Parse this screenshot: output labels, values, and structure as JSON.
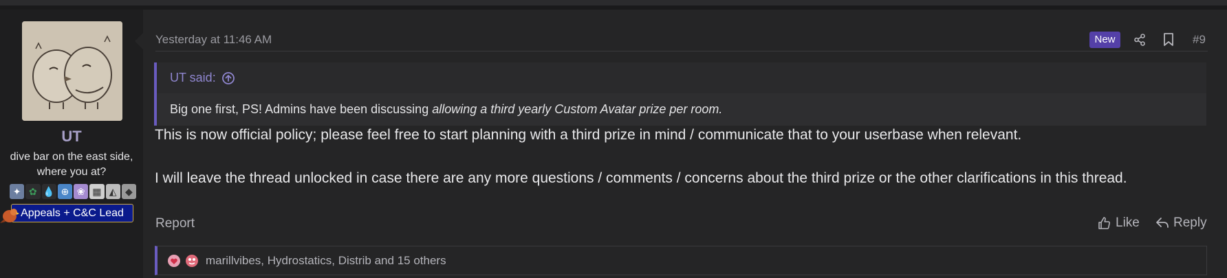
{
  "user": {
    "name": "UT",
    "title": "dive bar on the east side, where you at?",
    "role_banner": "Appeals + C&C Lead",
    "badge_colors": [
      "#6c7fa0",
      "#3c9a5a",
      "#2e7bd6",
      "#4a86c8",
      "#a58bd0",
      "#cfcfcf",
      "#bdbdbd",
      "#9a9a9a"
    ]
  },
  "post": {
    "date": "Yesterday at 11:46 AM",
    "new_label": "New",
    "number": "#9",
    "quote": {
      "author": "UT said:",
      "body_plain": "Big one first, PS! Admins have been discussing ",
      "body_italic": "allowing a third yearly Custom Avatar prize per room."
    },
    "message_lines": [
      "This is now official policy; please feel free to start planning with a third prize in mind / communicate that to your userbase when relevant.",
      "I will leave the thread unlocked in case there are any more questions / comments / concerns about the third prize or the other clarifications in this thread."
    ],
    "actions": {
      "report": "Report",
      "like": "Like",
      "reply": "Reply"
    },
    "reactions_text": "marillvibes, Hydrostatics, Distrib and 15 others"
  },
  "colors": {
    "accent": "#6a5cc0",
    "new_badge": "#5440a8",
    "role_banner_bg": "#0a1a8c",
    "role_banner_border": "#c9a84a"
  }
}
